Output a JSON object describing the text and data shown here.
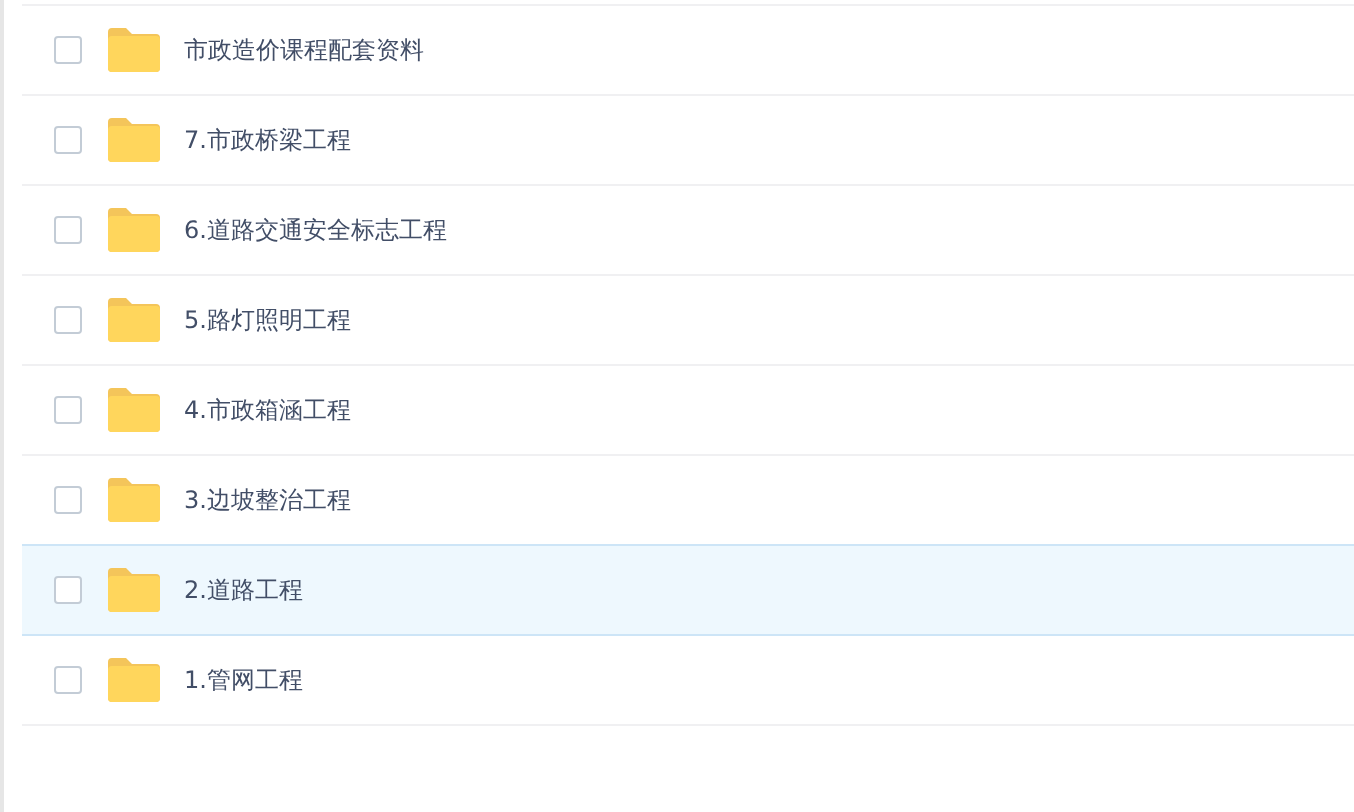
{
  "files": [
    {
      "name": "市政造价课程配套资料",
      "checked": false,
      "highlighted": false
    },
    {
      "name": "7.市政桥梁工程",
      "checked": false,
      "highlighted": false
    },
    {
      "name": "6.道路交通安全标志工程",
      "checked": false,
      "highlighted": false
    },
    {
      "name": "5.路灯照明工程",
      "checked": false,
      "highlighted": false
    },
    {
      "name": "4.市政箱涵工程",
      "checked": false,
      "highlighted": false
    },
    {
      "name": "3.边坡整治工程",
      "checked": false,
      "highlighted": false
    },
    {
      "name": "2.道路工程",
      "checked": false,
      "highlighted": true
    },
    {
      "name": "1.管网工程",
      "checked": false,
      "highlighted": false
    }
  ]
}
